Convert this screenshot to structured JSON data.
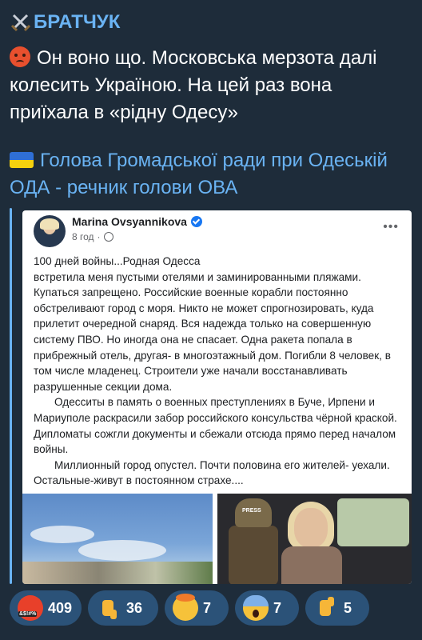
{
  "channel": {
    "name": "БРАТЧУК",
    "icon": "crossed-swords-icon"
  },
  "message": {
    "line1": "Он воно що. Московська мерзота далі колесить Україною. На цей раз вона приїхала в «рідну Одесу»",
    "line1_icon": "angry-face-icon",
    "line2": "Голова Громадської ради при Одеській ОДА - речник голови ОВА",
    "line2_icon": "ukraine-flag-icon"
  },
  "post": {
    "author": "Marina Ovsyannikova",
    "time": "8 год",
    "verified": true,
    "paragraphs": [
      "100 дней войны...Родная Одесса",
      "встретила меня пустыми отелями и заминированными пляжами. Купаться запрещено. Российские военные корабли постоянно обстреливают город с моря. Никто не может спрогнозировать, куда прилетит очередной снаряд. Вся надежда только на совершенную систему ПВО. Но иногда она не спасает.  Одна ракета попала в прибрежный отель, другая- в многоэтажный дом. Погибли 8 человек, в том числе младенец. Строители уже начали восстанавливать разрушенные секции дома.",
      "Одесситы в память о военных преступлениях в Буче, Ирпени и Мариуполе раскрасили забор российского консульства чёрной краской. Дипломаты сожгли документы и сбежали отсюда прямо перед началом войны.",
      "Миллионный город опустел. Почти половина его жителей- уехали. Остальные-живут в постоянном страхе...."
    ]
  },
  "reactions": [
    {
      "icon": "angry-cursing-face-icon",
      "count": "409"
    },
    {
      "icon": "thumbs-down-icon",
      "count": "36"
    },
    {
      "icon": "exploding-head-icon",
      "count": "7"
    },
    {
      "icon": "screaming-face-icon",
      "count": "7"
    },
    {
      "icon": "thumbs-up-icon",
      "count": "5"
    }
  ],
  "colors": {
    "background": "#1e2c3a",
    "accent": "#6ab3f3",
    "reaction_bg": "#2b5278"
  }
}
